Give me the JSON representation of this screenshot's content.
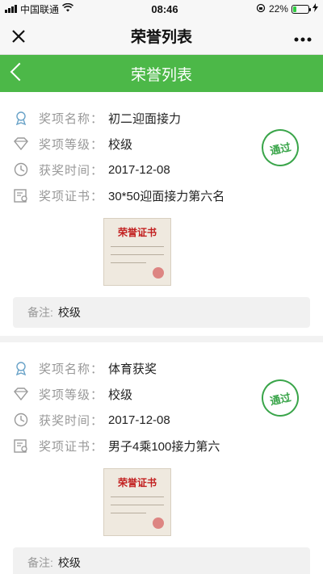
{
  "status_bar": {
    "carrier": "中国联通",
    "time": "08:46",
    "battery": "22%",
    "battery_level": 0.22
  },
  "wechat_nav": {
    "title": "荣誉列表",
    "close_icon": "close-icon",
    "more_icon": "more-icon"
  },
  "page_header": {
    "title": "荣誉列表",
    "accent": "#4cb848"
  },
  "awards": [
    {
      "name_label": "奖项名称：",
      "name": "初二迎面接力",
      "level_label": "奖项等级：",
      "level": "校级",
      "time_label": "获奖时间：",
      "time": "2017-12-08",
      "cert_label": "奖项证书：",
      "cert": "30*50迎面接力第六名",
      "stamp": "通过",
      "cert_image_title": "荣誉证书",
      "note_label": "备注:",
      "note": "校级"
    },
    {
      "name_label": "奖项名称：",
      "name": "体育获奖",
      "level_label": "奖项等级：",
      "level": "校级",
      "time_label": "获奖时间：",
      "time": "2017-12-08",
      "cert_label": "奖项证书：",
      "cert": "男子4乘100接力第六",
      "stamp": "通过",
      "cert_image_title": "荣誉证书",
      "note_label": "备注:",
      "note": "校级"
    }
  ],
  "colors": {
    "stamp_green": "#3aa54a",
    "label_gray": "#999999"
  }
}
